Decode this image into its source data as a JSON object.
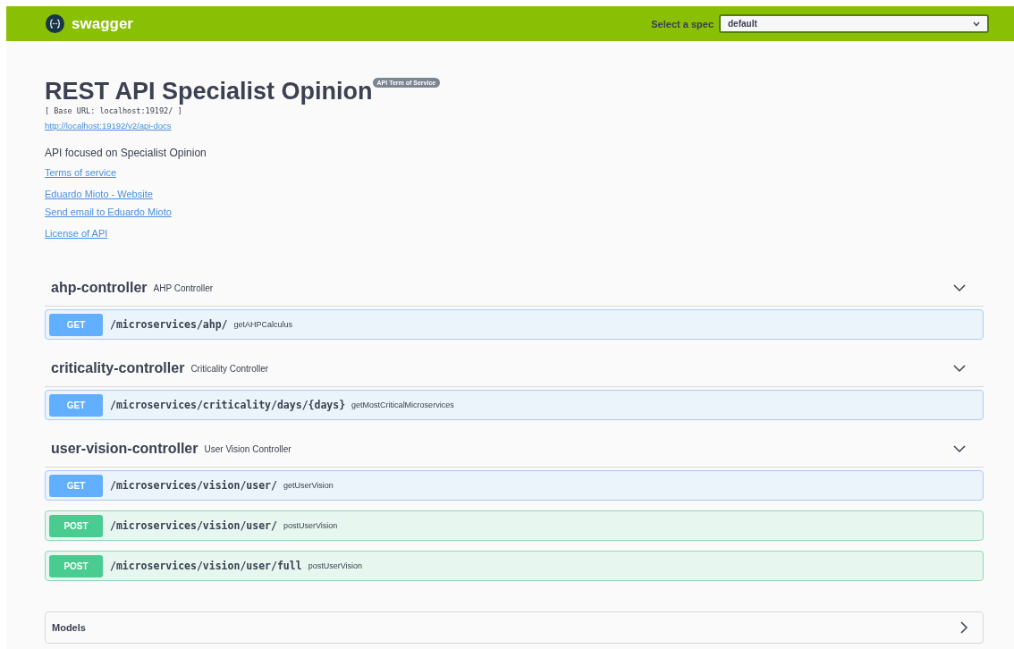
{
  "topbar": {
    "logo_text": "swagger",
    "spec_label": "Select a spec",
    "spec_value": "default"
  },
  "info": {
    "title": "REST API Specialist Opinion",
    "badge": "API Term of Service",
    "base_url": "[ Base URL: localhost:19192/ ]",
    "docs_link": "http://localhost:19192/v2/api-docs",
    "description": "API focused on Specialist Opinion",
    "link_groups": [
      [
        "Terms of service"
      ],
      [
        "Eduardo Mioto - Website",
        "Send email to Eduardo Mioto"
      ],
      [
        "License of API"
      ]
    ]
  },
  "controllers": [
    {
      "name": "ahp-controller",
      "description": "AHP Controller",
      "expanded": true,
      "operations": [
        {
          "method": "GET",
          "kind": "get",
          "path": "/microservices/ahp/",
          "summary": "getAHPCalculus"
        }
      ]
    },
    {
      "name": "criticality-controller",
      "description": "Criticality Controller",
      "expanded": true,
      "operations": [
        {
          "method": "GET",
          "kind": "get",
          "path": "/microservices/criticality/days/{days}",
          "summary": "getMostCriticalMicroservices"
        }
      ]
    },
    {
      "name": "user-vision-controller",
      "description": "User Vision Controller",
      "expanded": true,
      "operations": [
        {
          "method": "GET",
          "kind": "get",
          "path": "/microservices/vision/user/",
          "summary": "getUserVision"
        },
        {
          "method": "POST",
          "kind": "post",
          "path": "/microservices/vision/user/",
          "summary": "postUserVision"
        },
        {
          "method": "POST",
          "kind": "post",
          "path": "/microservices/vision/user/full",
          "summary": "postUserVision"
        }
      ]
    }
  ],
  "models": {
    "title": "Models",
    "expanded": false
  }
}
